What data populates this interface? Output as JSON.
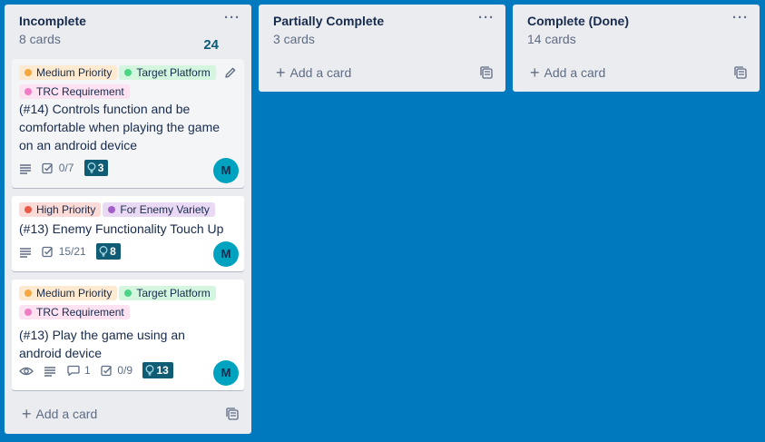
{
  "lists": [
    {
      "title": "Incomplete",
      "count": "8 cards",
      "points": "24",
      "menu": "···",
      "add_card": "Add a card",
      "cards": [
        {
          "labels": [
            {
              "text": "Medium Priority",
              "color": "orange"
            },
            {
              "text": "Target Platform",
              "color": "green"
            },
            {
              "text": "TRC Requirement",
              "color": "pink"
            }
          ],
          "title": "(#14) Controls function and be comfortable when playing the game on an android device",
          "checklist": "0/7",
          "points": "3",
          "avatar": "M"
        },
        {
          "labels": [
            {
              "text": "High Priority",
              "color": "red"
            },
            {
              "text": "For Enemy Variety",
              "color": "purple"
            }
          ],
          "title": "(#13) Enemy Functionality Touch Up",
          "checklist": "15/21",
          "points": "8",
          "avatar": "M"
        },
        {
          "labels": [
            {
              "text": "Medium Priority",
              "color": "orange"
            },
            {
              "text": "Target Platform",
              "color": "green"
            },
            {
              "text": "TRC Requirement",
              "color": "pink"
            }
          ],
          "title": "(#13) Play the game using an android device",
          "comments": "1",
          "checklist": "0/9",
          "points": "13",
          "avatar": "M"
        }
      ]
    },
    {
      "title": "Partially Complete",
      "count": "3 cards",
      "menu": "···",
      "add_card": "Add a card"
    },
    {
      "title": "Complete (Done)",
      "count": "14 cards",
      "menu": "···",
      "add_card": "Add a card"
    }
  ],
  "colors": {
    "board_bg": "#0079bf",
    "list_bg": "#ebecf0",
    "points_badge": "#0f5c74",
    "avatar": "#00a3bf"
  }
}
